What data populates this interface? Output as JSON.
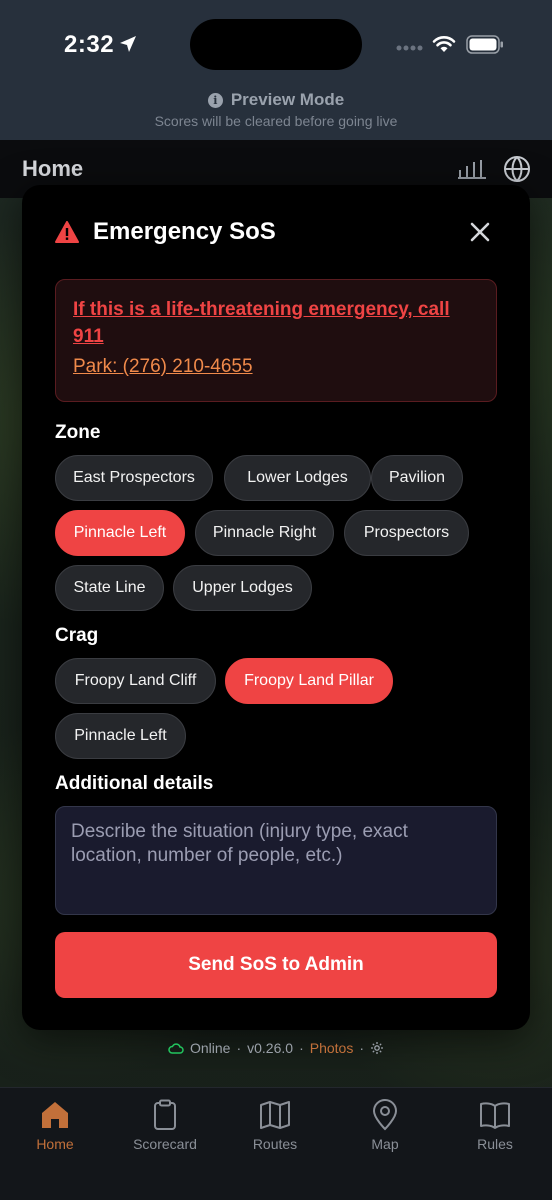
{
  "status_bar": {
    "time": "2:32"
  },
  "preview": {
    "title": "Preview Mode",
    "subtitle": "Scores will be cleared before going live"
  },
  "header": {
    "title": "Home"
  },
  "modal": {
    "title": "Emergency SoS",
    "alert": {
      "emergency_text": "If this is a life-threatening emergency, call 911",
      "park_phone": "Park: (276) 210-4655"
    },
    "zone": {
      "label": "Zone",
      "options": [
        "East Prospectors",
        "Lower Lodges",
        "Pavilion",
        "Pinnacle Left",
        "Pinnacle Right",
        "Prospectors",
        "State Line",
        "Upper Lodges"
      ],
      "selected": "Pinnacle Left"
    },
    "crag": {
      "label": "Crag",
      "options": [
        "Froopy Land Cliff",
        "Froopy Land Pillar",
        "Pinnacle Left"
      ],
      "selected": "Froopy Land Pillar"
    },
    "details": {
      "label": "Additional details",
      "placeholder": "Describe the situation (injury type, exact location, number of people, etc.)",
      "value": ""
    },
    "send_label": "Send SoS to Admin"
  },
  "footer_status": {
    "online": "Online",
    "version": "v0.26.0",
    "photos": "Photos",
    "separator": "·"
  },
  "tabbar": {
    "active": "Home",
    "items": [
      {
        "label": "Home",
        "icon": "home-icon"
      },
      {
        "label": "Scorecard",
        "icon": "scorecard-icon"
      },
      {
        "label": "Routes",
        "icon": "map-fold-icon"
      },
      {
        "label": "Map",
        "icon": "map-pin-icon"
      },
      {
        "label": "Rules",
        "icon": "book-icon"
      }
    ]
  },
  "colors": {
    "accent_red": "#ef4444",
    "accent_orange": "#c2703a",
    "online_green": "#22c55e"
  }
}
